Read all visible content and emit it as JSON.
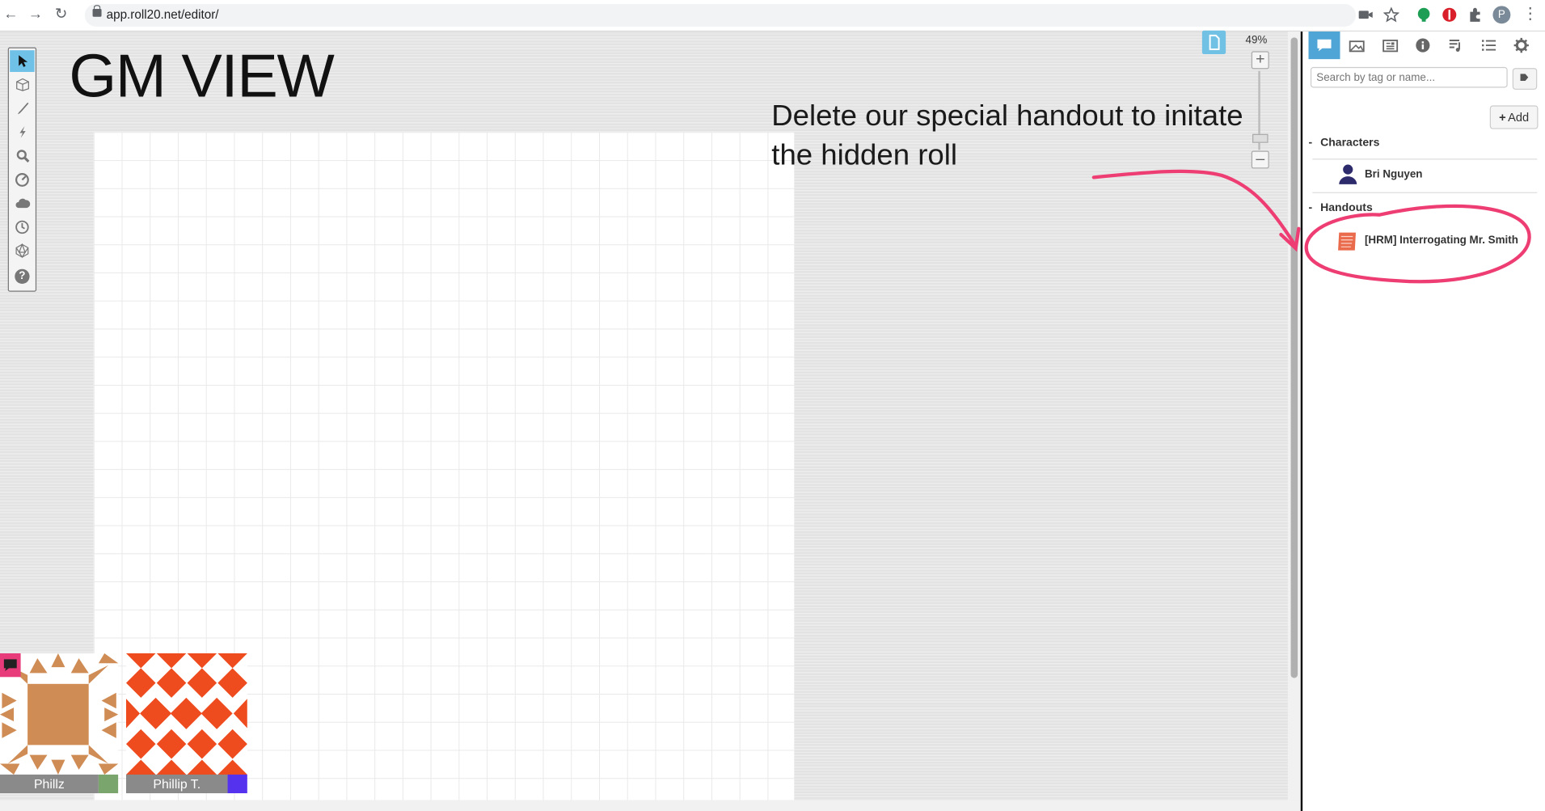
{
  "browser": {
    "url": "app.roll20.net/editor/",
    "avatar_letter": "P"
  },
  "canvas": {
    "title": "GM VIEW",
    "annotation_line1": "Delete our special handout to initate",
    "annotation_line2": "the hidden roll",
    "zoom": "49%"
  },
  "toolbar": {
    "tools": [
      "select-tool",
      "layers-tool",
      "draw-tool",
      "fx-tool",
      "zoom-tool",
      "measure-tool",
      "fog-tool",
      "turn-tracker-tool",
      "dice-tool",
      "help-tool"
    ]
  },
  "sidebar": {
    "tabs": [
      "chat",
      "art-library",
      "journal",
      "compendium",
      "jukebox",
      "collections",
      "settings"
    ],
    "search_placeholder": "Search by tag or name...",
    "add_label": "Add",
    "characters_folder": "Characters",
    "character_name": "Bri Nguyen",
    "handouts_folder": "Handouts",
    "handout_name": "[HRM] Interrogating Mr. Smith",
    "accent_color": "#4fa5d6"
  },
  "players": [
    {
      "name": "Phillz",
      "color": "#7aa66e"
    },
    {
      "name": "Phillip T.",
      "color": "#5533ee"
    }
  ],
  "annotation_color": "#ee3d72"
}
